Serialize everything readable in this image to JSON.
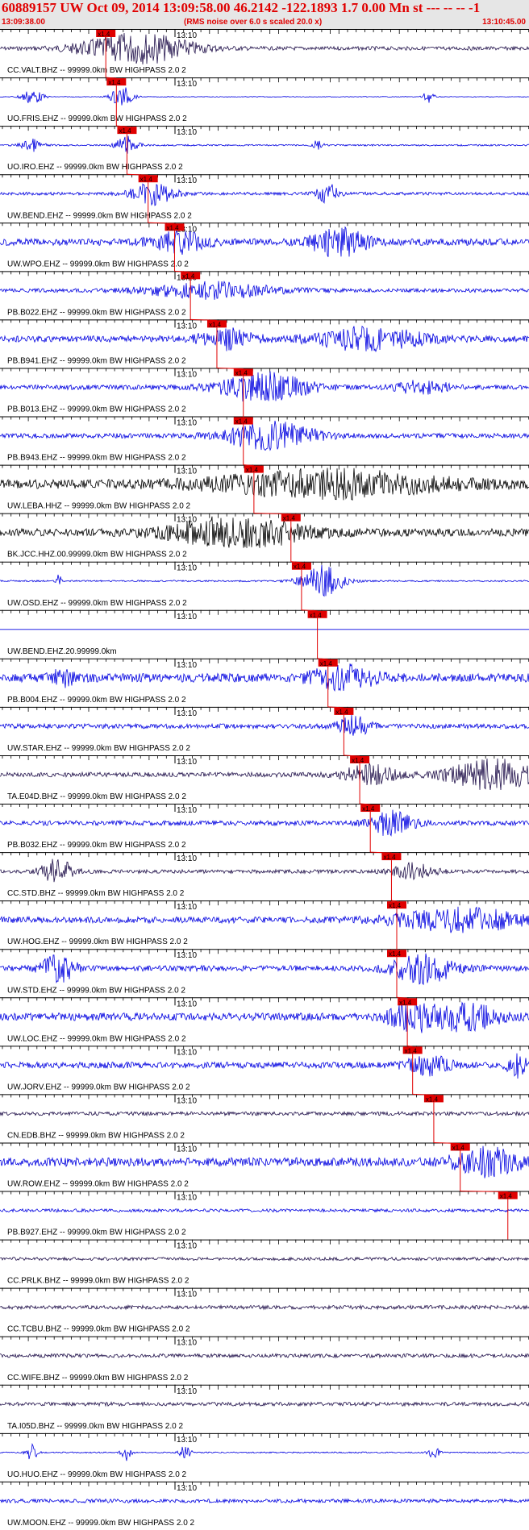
{
  "header": {
    "title": "60889157 UW Oct 09, 2014 13:09:58.00   46.2142 -122.1893  1.7 0.00 Mn st --- -- --   -1",
    "start_time": "13:09:38.00",
    "rms_note": "(RMS noise over 6.0 s scaled 20.0 x)",
    "end_time": "13:10:45.00"
  },
  "minute_label": "13:10",
  "pick_label": "x1.4",
  "colors": {
    "header_text": "#e00000",
    "header_bg": "#e6e6e6",
    "trace_blue": "#0000e0",
    "trace_black": "#000000",
    "trace_navy": "#20104a",
    "pick": "#e00000"
  },
  "traces": [
    {
      "label": "CC.VALT.BHZ -- 99999.0km BW  HIGHPASS  2.0  2",
      "color": "navy",
      "noise": 0.12,
      "events": [
        {
          "t": 0.26,
          "amp": 1.0,
          "w": 0.1
        }
      ],
      "pick": 0.2
    },
    {
      "label": "UO.FRIS.EHZ -- 99999.0km BW  HIGHPASS  2.0  2",
      "color": "blue",
      "noise": 0.02,
      "events": [
        {
          "t": 0.06,
          "amp": 0.5,
          "w": 0.02
        },
        {
          "t": 0.23,
          "amp": 0.7,
          "w": 0.02
        },
        {
          "t": 0.81,
          "amp": 0.4,
          "w": 0.01
        }
      ],
      "pick": 0.22
    },
    {
      "label": "UO.IRO.EHZ -- 99999.0km BW  HIGHPASS  2.0  2",
      "color": "blue",
      "noise": 0.05,
      "events": [
        {
          "t": 0.06,
          "amp": 0.4,
          "w": 0.02
        },
        {
          "t": 0.24,
          "amp": 0.6,
          "w": 0.02
        },
        {
          "t": 0.6,
          "amp": 0.3,
          "w": 0.01
        }
      ],
      "pick": 0.24
    },
    {
      "label": "UW.BEND.EHZ -- 99999.0km BW  HIGHPASS  2.0  2",
      "color": "blue",
      "noise": 0.1,
      "events": [
        {
          "t": 0.29,
          "amp": 0.7,
          "w": 0.04
        },
        {
          "t": 0.62,
          "amp": 0.6,
          "w": 0.02
        }
      ],
      "pick": 0.28
    },
    {
      "label": "UW.WPO.EHZ -- 99999.0km BW  HIGHPASS  2.0  2",
      "color": "blue",
      "noise": 0.22,
      "events": [
        {
          "t": 0.34,
          "amp": 0.6,
          "w": 0.05
        },
        {
          "t": 0.64,
          "amp": 0.9,
          "w": 0.05
        }
      ],
      "pick": 0.33
    },
    {
      "label": "PB.B022.EHZ -- 99999.0km BW  HIGHPASS  2.0  2",
      "color": "blue",
      "noise": 0.12,
      "events": [
        {
          "t": 0.4,
          "amp": 0.5,
          "w": 0.12
        }
      ],
      "pick": 0.36
    },
    {
      "label": "PB.B941.EHZ -- 99999.0km BW  HIGHPASS  2.0  2",
      "color": "blue",
      "noise": 0.2,
      "events": [
        {
          "t": 0.43,
          "amp": 0.6,
          "w": 0.05
        },
        {
          "t": 0.7,
          "amp": 0.7,
          "w": 0.1
        }
      ],
      "pick": 0.41
    },
    {
      "label": "PB.B013.EHZ -- 99999.0km BW  HIGHPASS  2.0  2",
      "color": "blue",
      "noise": 0.15,
      "events": [
        {
          "t": 0.5,
          "amp": 1.0,
          "w": 0.08
        },
        {
          "t": 0.8,
          "amp": 0.4,
          "w": 0.05
        }
      ],
      "pick": 0.46
    },
    {
      "label": "PB.B943.EHZ -- 99999.0km BW  HIGHPASS  2.0  2",
      "color": "blue",
      "noise": 0.15,
      "events": [
        {
          "t": 0.51,
          "amp": 1.0,
          "w": 0.08
        }
      ],
      "pick": 0.46
    },
    {
      "label": "UW.LEBA.HHZ -- 99999.0km BW  HIGHPASS  2.0  2",
      "color": "black",
      "noise": 0.3,
      "events": [
        {
          "t": 0.62,
          "amp": 0.8,
          "w": 0.2
        }
      ],
      "pick": 0.48
    },
    {
      "label": "BK.JCC.HHZ.00.99999.0km BW  HIGHPASS  2.0  2",
      "color": "black",
      "noise": 0.25,
      "events": [
        {
          "t": 0.45,
          "amp": 1.0,
          "w": 0.12
        }
      ],
      "pick": 0.55
    },
    {
      "label": "UW.OSD.EHZ -- 99999.0km BW  HIGHPASS  2.0  2",
      "color": "blue",
      "noise": 0.05,
      "events": [
        {
          "t": 0.11,
          "amp": 0.5,
          "w": 0.005
        },
        {
          "t": 0.61,
          "amp": 1.0,
          "w": 0.04
        }
      ],
      "pick": 0.57
    },
    {
      "label": "UW.BEND.EHZ.20.99999.0km",
      "color": "blue",
      "noise": 0.0,
      "events": [],
      "pick": 0.6
    },
    {
      "label": "PB.B004.EHZ -- 99999.0km BW  HIGHPASS  2.0  2",
      "color": "blue",
      "noise": 0.28,
      "events": [
        {
          "t": 0.12,
          "amp": 0.5,
          "w": 0.02
        },
        {
          "t": 0.65,
          "amp": 0.7,
          "w": 0.06
        }
      ],
      "pick": 0.62
    },
    {
      "label": "UW.STAR.EHZ -- 99999.0km BW  HIGHPASS  2.0  2",
      "color": "blue",
      "noise": 0.15,
      "events": [
        {
          "t": 0.67,
          "amp": 0.6,
          "w": 0.03
        }
      ],
      "pick": 0.65
    },
    {
      "label": "TA.E04D.BHZ -- 99999.0km BW  HIGHPASS  2.0  2",
      "color": "navy",
      "noise": 0.15,
      "events": [
        {
          "t": 0.7,
          "amp": 0.6,
          "w": 0.05
        },
        {
          "t": 0.93,
          "amp": 1.0,
          "w": 0.08
        }
      ],
      "pick": 0.68
    },
    {
      "label": "PB.B032.EHZ -- 99999.0km BW  HIGHPASS  2.0  2",
      "color": "blue",
      "noise": 0.15,
      "events": [
        {
          "t": 0.74,
          "amp": 0.8,
          "w": 0.04
        }
      ],
      "pick": 0.7
    },
    {
      "label": "CC.STD.BHZ -- 99999.0km BW  HIGHPASS  2.0  2",
      "color": "navy",
      "noise": 0.12,
      "events": [
        {
          "t": 0.11,
          "amp": 0.8,
          "w": 0.03
        },
        {
          "t": 0.78,
          "amp": 0.5,
          "w": 0.04
        }
      ],
      "pick": 0.74
    },
    {
      "label": "UW.HOG.EHZ -- 99999.0km BW  HIGHPASS  2.0  2",
      "color": "blue",
      "noise": 0.2,
      "events": [
        {
          "t": 0.87,
          "amp": 0.7,
          "w": 0.12
        }
      ],
      "pick": 0.75
    },
    {
      "label": "UW.STD.EHZ -- 99999.0km BW  HIGHPASS  2.0  2",
      "color": "blue",
      "noise": 0.18,
      "events": [
        {
          "t": 0.11,
          "amp": 1.0,
          "w": 0.03
        },
        {
          "t": 0.8,
          "amp": 0.9,
          "w": 0.06
        }
      ],
      "pick": 0.75
    },
    {
      "label": "UW.LOC.EHZ -- 99999.0km BW  HIGHPASS  2.0  2",
      "color": "blue",
      "noise": 0.25,
      "events": [
        {
          "t": 0.78,
          "amp": 1.0,
          "w": 0.04
        },
        {
          "t": 0.88,
          "amp": 0.8,
          "w": 0.06
        }
      ],
      "pick": 0.77
    },
    {
      "label": "UW.JORV.EHZ -- 99999.0km BW  HIGHPASS  2.0  2",
      "color": "blue",
      "noise": 0.2,
      "events": [
        {
          "t": 0.81,
          "amp": 0.6,
          "w": 0.04
        },
        {
          "t": 0.98,
          "amp": 0.7,
          "w": 0.02
        }
      ],
      "pick": 0.78
    },
    {
      "label": "CN.EDB.BHZ -- 99999.0km BW  HIGHPASS  2.0  2",
      "color": "navy",
      "noise": 0.12,
      "events": [],
      "pick": 0.82
    },
    {
      "label": "UW.ROW.EHZ -- 99999.0km BW  HIGHPASS  2.0  2",
      "color": "blue",
      "noise": 0.28,
      "events": [
        {
          "t": 0.92,
          "amp": 0.8,
          "w": 0.06
        }
      ],
      "pick": 0.87
    },
    {
      "label": "PB.B927.EHZ -- 99999.0km BW  HIGHPASS  2.0  2",
      "color": "blue",
      "noise": 0.1,
      "events": [],
      "pick": 0.96
    },
    {
      "label": "CC.PRLK.BHZ -- 99999.0km BW  HIGHPASS  2.0  2",
      "color": "navy",
      "noise": 0.1,
      "events": [],
      "pick": null
    },
    {
      "label": "CC.TCBU.BHZ -- 99999.0km BW  HIGHPASS  2.0  2",
      "color": "navy",
      "noise": 0.12,
      "events": [],
      "pick": null
    },
    {
      "label": "CC.WIFE.BHZ -- 99999.0km BW  HIGHPASS  2.0  2",
      "color": "navy",
      "noise": 0.12,
      "events": [],
      "pick": null
    },
    {
      "label": "TA.I05D.BHZ -- 99999.0km BW  HIGHPASS  2.0  2",
      "color": "navy",
      "noise": 0.12,
      "events": [],
      "pick": null
    },
    {
      "label": "UO.HUO.EHZ -- 99999.0km BW  HIGHPASS  2.0  2",
      "color": "blue",
      "noise": 0.04,
      "events": [
        {
          "t": 0.06,
          "amp": 0.6,
          "w": 0.01
        },
        {
          "t": 0.24,
          "amp": 0.5,
          "w": 0.01
        },
        {
          "t": 0.35,
          "amp": 0.5,
          "w": 0.01
        },
        {
          "t": 0.82,
          "amp": 0.4,
          "w": 0.01
        }
      ],
      "pick": null
    },
    {
      "label": "UW.MOON.EHZ -- 99999.0km BW  HIGHPASS  2.0  2",
      "color": "blue",
      "noise": 0.12,
      "events": [],
      "pick": null
    }
  ]
}
